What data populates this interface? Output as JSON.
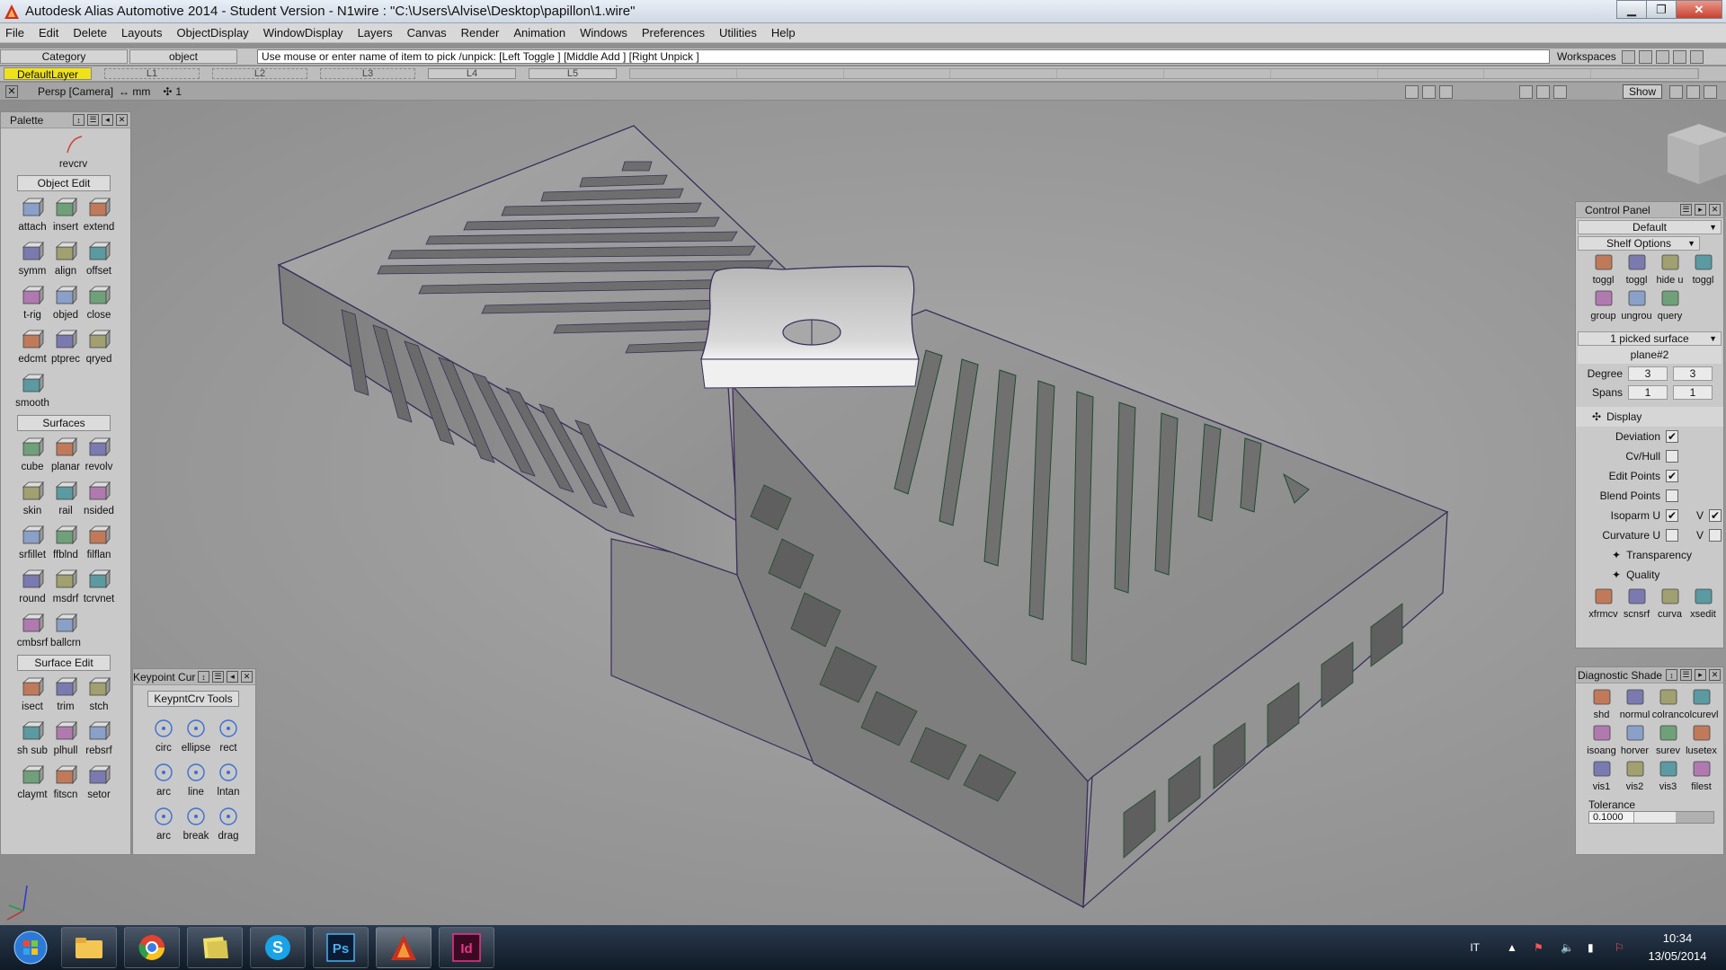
{
  "window": {
    "title": "Autodesk Alias Automotive 2014   - Student Version   - N1wire : \"C:\\Users\\Alvise\\Desktop\\papillon\\1.wire\"",
    "controls": {
      "minimize": "▁",
      "maximize": "❐",
      "close": "✕"
    }
  },
  "menu": [
    "File",
    "Edit",
    "Delete",
    "Layouts",
    "ObjectDisplay",
    "WindowDisplay",
    "Layers",
    "Canvas",
    "Render",
    "Animation",
    "Windows",
    "Preferences",
    "Utilities",
    "Help"
  ],
  "prompt": {
    "category": "Category",
    "object": "object",
    "message": "Use mouse or enter name of item to pick /unpick: [Left Toggle ] [Middle Add ] [Right Unpick ]",
    "workspaces": "Workspaces"
  },
  "layers": {
    "default": "DefaultLayer",
    "items": [
      "L1",
      "L2",
      "L3",
      "L4",
      "L5"
    ]
  },
  "viewport": {
    "label": "Persp [Camera]",
    "units": "↔ mm",
    "grid": "1",
    "show_label": "Show"
  },
  "palette": {
    "title": "Palette",
    "first_tool": "revcrv",
    "sections": [
      {
        "name": "Object Edit",
        "tools": [
          "attach",
          "insert",
          "extend",
          "symm",
          "align",
          "offset",
          "t-rig",
          "objed",
          "close",
          "edcmt",
          "ptprec",
          "qryed",
          "smooth"
        ]
      },
      {
        "name": "Surfaces",
        "tools": [
          "cube",
          "planar",
          "revolv",
          "skin",
          "rail",
          "nsided",
          "srfillet",
          "ffblnd",
          "filflan",
          "round",
          "msdrf",
          "tcrvnet",
          "cmbsrf",
          "ballcrn"
        ]
      },
      {
        "name": "Surface Edit",
        "tools": [
          "isect",
          "trim",
          "stch",
          "sh sub",
          "plhull",
          "rebsrf",
          "claymt",
          "fitscn",
          "setor"
        ]
      }
    ]
  },
  "keypoint": {
    "title": "Keypoint Cur",
    "tab": "KeypntCrv Tools",
    "tools": [
      "circ",
      "ellipse",
      "rect",
      "arc",
      "line",
      "lntan",
      "arc",
      "break",
      "drag"
    ]
  },
  "control_panel": {
    "title": "Control Panel",
    "preset": "Default",
    "shelf_options": "Shelf Options",
    "shelf_tools": [
      "toggl",
      "toggl",
      "hide u",
      "toggl",
      "group",
      "ungrou",
      "query"
    ],
    "picked": "1 picked surface",
    "object_name": "plane#2",
    "degree_label": "Degree",
    "degree_u": "3",
    "degree_v": "3",
    "spans_label": "Spans",
    "spans_u": "1",
    "spans_v": "1",
    "display_label": "Display",
    "rows": [
      {
        "label": "Deviation",
        "checked": true
      },
      {
        "label": "Cv/Hull",
        "checked": false
      },
      {
        "label": "Edit Points",
        "checked": true
      },
      {
        "label": "Blend Points",
        "checked": false
      }
    ],
    "isoparm": {
      "label": "Isoparm U",
      "u": true,
      "v_label": "V",
      "v": true
    },
    "curvature": {
      "label": "Curvature U",
      "u": false,
      "v_label": "V",
      "v": false
    },
    "transparency": "Transparency",
    "quality": "Quality",
    "bottom_tools": [
      "xfrmcv",
      "scnsrf",
      "curva",
      "xsedit"
    ]
  },
  "diagnostic": {
    "title": "Diagnostic Shade",
    "tools": [
      "shd",
      "normul",
      "colranc",
      "olcurevl",
      "isoang",
      "horver",
      "surev",
      "lusetex",
      "vis1",
      "vis2",
      "vis3",
      "filest"
    ],
    "tolerance_label": "Tolerance",
    "tolerance_value": "0.1000"
  },
  "taskbar": {
    "apps": [
      "explorer",
      "chrome",
      "folder",
      "skype",
      "photoshop",
      "alias",
      "indesign"
    ],
    "ps_label": "Ps",
    "id_label": "Id",
    "s_label": "S",
    "lang": "IT",
    "time": "10:34",
    "date": "13/05/2014"
  },
  "colors": {
    "layer_default": "#f0e21a",
    "close_button": "#c8412f",
    "panel_bg": "#c9c9c9",
    "model_gray": "#8a8a8a"
  }
}
